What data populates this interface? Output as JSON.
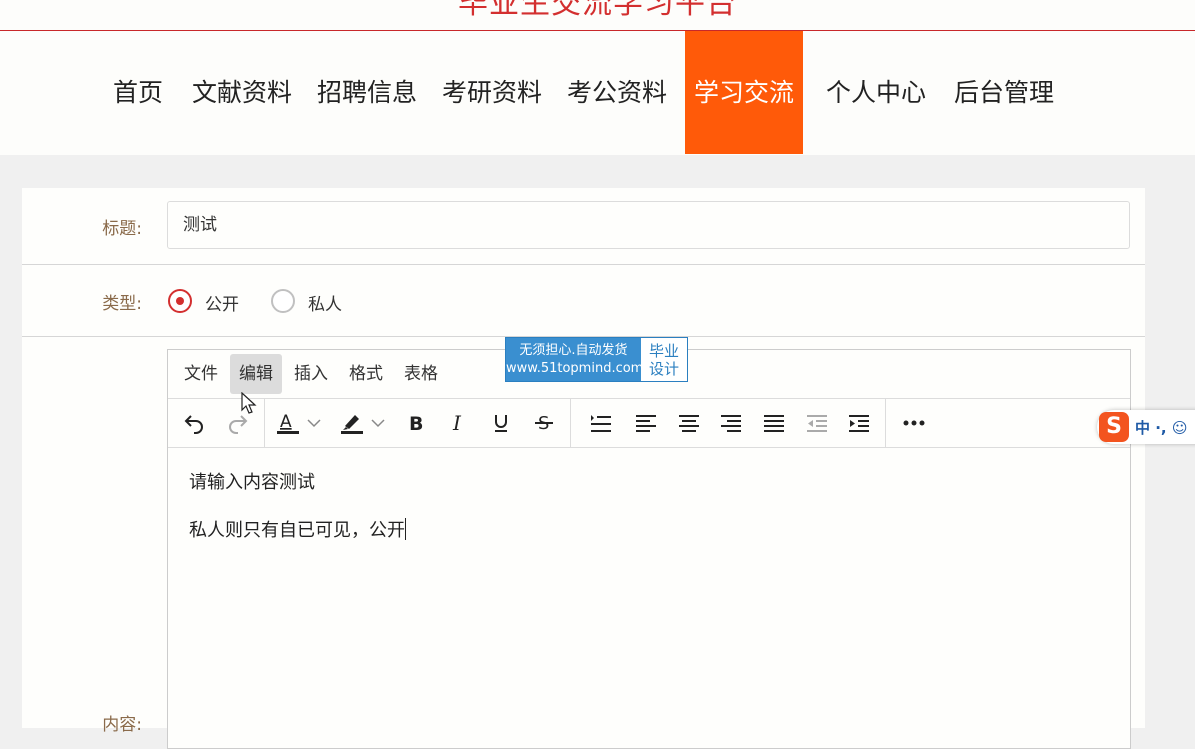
{
  "header": {
    "site_title": "毕业生交流学习平台",
    "accent_color": "#ff5a09",
    "title_color": "#d32f2f"
  },
  "nav": {
    "items": [
      {
        "label": "首页"
      },
      {
        "label": "文献资料"
      },
      {
        "label": "招聘信息"
      },
      {
        "label": "考研资料"
      },
      {
        "label": "考公资料"
      },
      {
        "label": "学习交流",
        "active": true
      },
      {
        "label": "个人中心"
      },
      {
        "label": "后台管理"
      }
    ]
  },
  "form": {
    "title_label": "标题:",
    "title_value": "测试",
    "type_label": "类型:",
    "type_options": [
      {
        "label": "公开",
        "checked": true
      },
      {
        "label": "私人",
        "checked": false
      }
    ],
    "content_label": "内容:"
  },
  "editor": {
    "menus": [
      "文件",
      "编辑",
      "插入",
      "格式",
      "表格"
    ],
    "hovered_menu": "编辑",
    "toolbar_icons": [
      "undo-icon",
      "redo-icon",
      "text-color-icon",
      "highlight-color-icon",
      "bold-icon",
      "italic-icon",
      "underline-icon",
      "strikethrough-icon",
      "line-height-icon",
      "align-left-icon",
      "align-center-icon",
      "align-right-icon",
      "align-justify-icon",
      "outdent-icon",
      "indent-icon",
      "more-icon"
    ],
    "content_lines": [
      "请输入内容测试",
      "私人则只有自已可见，公开"
    ]
  },
  "watermark": {
    "line1": "无须担心.自动发货",
    "line2": "www.51topmind.com",
    "badge_line1": "毕业",
    "badge_line2": "设计"
  },
  "ime": {
    "logo": "S",
    "text": "中 ·, ☺"
  }
}
